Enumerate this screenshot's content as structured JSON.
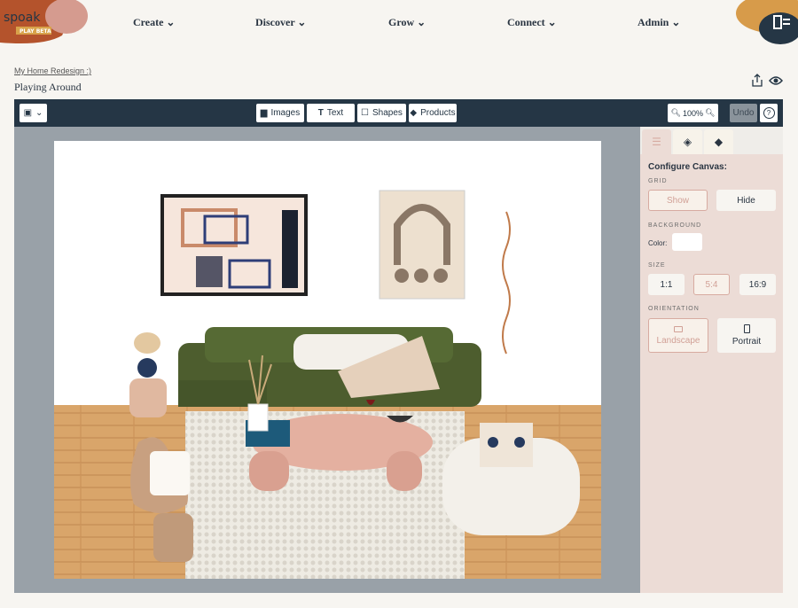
{
  "brand": {
    "name": "spoak",
    "badge": "PLAY BETA"
  },
  "nav": [
    {
      "label": "Create ⌄"
    },
    {
      "label": "Discover ⌄"
    },
    {
      "label": "Grow ⌄"
    },
    {
      "label": "Connect ⌄"
    },
    {
      "label": "Admin ⌄"
    }
  ],
  "breadcrumb": "My Home Redesign :)",
  "page_title": "Playing Around",
  "toolbar": {
    "images": "Images",
    "text": "Text",
    "shapes": "Shapes",
    "products": "Products",
    "zoom": "100%",
    "undo": "Undo",
    "help": "?"
  },
  "panel": {
    "title": "Configure Canvas:",
    "grid_label": "GRID",
    "grid_show": "Show",
    "grid_hide": "Hide",
    "grid_selected": "Show",
    "background_label": "BACKGROUND",
    "color_label": "Color:",
    "background_color": "#ffffff",
    "size_label": "SIZE",
    "sizes": [
      "1:1",
      "5:4",
      "16:9"
    ],
    "size_selected": "5:4",
    "orientation_label": "ORIENTATION",
    "landscape": "Landscape",
    "portrait": "Portrait",
    "orientation_selected": "Landscape"
  },
  "colors": {
    "toolbar": "#253645",
    "accent": "#d7aba1",
    "panel": "#ecdcd6"
  }
}
